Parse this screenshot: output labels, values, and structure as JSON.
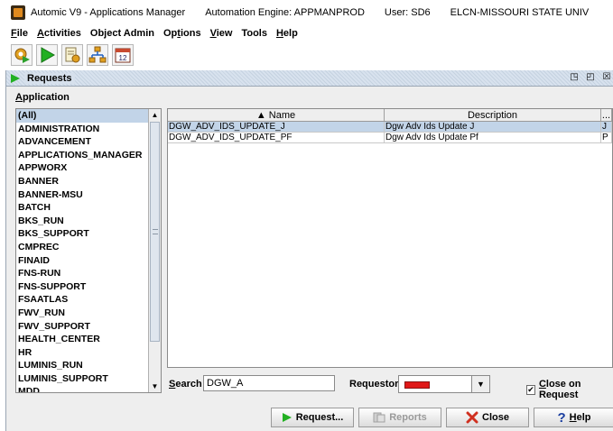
{
  "window": {
    "title_app": "Automic V9 - Applications Manager",
    "title_engine": "Automation Engine: APPMANPROD",
    "title_user": "User: SD6",
    "title_org": "ELCN-MISSOURI STATE UNIV"
  },
  "menu": [
    {
      "pre": "",
      "u": "F",
      "post": "ile"
    },
    {
      "pre": "",
      "u": "A",
      "post": "ctivities"
    },
    {
      "pre": "Object Admin",
      "u": "",
      "post": ""
    },
    {
      "pre": "Op",
      "u": "t",
      "post": "ions"
    },
    {
      "pre": "",
      "u": "V",
      "post": "iew"
    },
    {
      "pre": "Tools",
      "u": "",
      "post": ""
    },
    {
      "pre": "",
      "u": "H",
      "post": "elp"
    }
  ],
  "toolbar_icons": [
    "gear-play-icon",
    "play-icon",
    "document-gear-icon",
    "network-icon",
    "calendar-icon"
  ],
  "toolbar_calendar_text": "12",
  "frame": {
    "title": "Requests",
    "controls": [
      "◳",
      "◰",
      "☒"
    ]
  },
  "application_label": {
    "u": "A",
    "post": "pplication"
  },
  "applications": [
    "(All)",
    "ADMINISTRATION",
    "ADVANCEMENT",
    "APPLICATIONS_MANAGER",
    "APPWORX",
    "BANNER",
    "BANNER-MSU",
    "BATCH",
    "BKS_RUN",
    "BKS_SUPPORT",
    "CMPREC",
    "FINAID",
    "FNS-RUN",
    "FNS-SUPPORT",
    "FSAATLAS",
    "FWV_RUN",
    "FWV_SUPPORT",
    "HEALTH_CENTER",
    "HR",
    "LUMINIS_RUN",
    "LUMINIS_SUPPORT",
    "MDD"
  ],
  "table": {
    "columns": {
      "name": "▲ Name",
      "description": "Description",
      "extra": "..."
    },
    "rows": [
      {
        "name": "DGW_ADV_IDS_UPDATE_J",
        "description": "Dgw Adv Ids Update J",
        "extra": "J"
      },
      {
        "name": "DGW_ADV_IDS_UPDATE_PF",
        "description": "Dgw Adv Ids Update Pf",
        "extra": "P"
      }
    ]
  },
  "search": {
    "label_u": "S",
    "label_post": "earch",
    "value": "DGW_A"
  },
  "requestor": {
    "label": "Requestor",
    "color": "#e01818"
  },
  "close_on_request": {
    "checked": true,
    "label_u": "C",
    "label_post": "lose on Request"
  },
  "buttons": {
    "request": "Request...",
    "reports": "Reports",
    "close": "Close",
    "help_u": "H",
    "help_post": "elp"
  }
}
